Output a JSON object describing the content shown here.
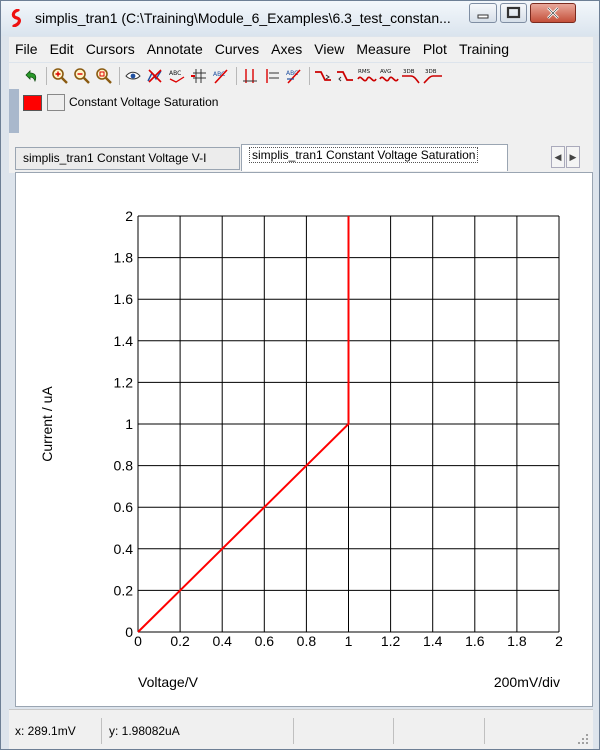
{
  "window": {
    "title": "simplis_tran1 (C:\\Training\\Module_6_Examples\\6.3_test_constan..."
  },
  "menu": [
    "File",
    "Edit",
    "Cursors",
    "Annotate",
    "Curves",
    "Axes",
    "View",
    "Measure",
    "Plot",
    "Training"
  ],
  "toolbar": {
    "icons": [
      "undo-icon",
      "zoom-in-icon",
      "zoom-out-icon",
      "zoom-fit-icon",
      "eye-icon",
      "delete-curve-icon",
      "abc-label-icon",
      "add-grid-icon",
      "abc-slash-icon",
      "cursor-lines-icon",
      "cursor-lines-2-icon",
      "abc-curve-icon",
      "edge-rise-icon",
      "edge-fall-icon",
      "rms-icon",
      "avg-icon",
      "3db-icon",
      "3db-up-icon"
    ],
    "text_labels": {
      "rms": "RMS",
      "avg": "AVG",
      "db1": "3DB",
      "db2": "3DB"
    }
  },
  "legend": {
    "label": "Constant Voltage Saturation",
    "color": "#ff0000"
  },
  "tabs": [
    {
      "label": "simplis_tran1 Constant Voltage V-I",
      "active": false
    },
    {
      "label": "simplis_tran1 Constant Voltage Saturation",
      "active": true
    }
  ],
  "chart_data": {
    "type": "line",
    "series": [
      {
        "name": "Constant Voltage Saturation",
        "color": "#ff0000",
        "x": [
          0,
          0.2,
          0.4,
          0.6,
          0.8,
          1,
          1,
          1
        ],
        "y": [
          0,
          0.2,
          0.4,
          0.6,
          0.8,
          1,
          1.5,
          2
        ]
      }
    ],
    "xlim": [
      0,
      2
    ],
    "ylim": [
      0,
      2
    ],
    "xticks": [
      "0",
      "0.2",
      "0.4",
      "0.6",
      "0.8",
      "1",
      "1.2",
      "1.4",
      "1.6",
      "1.8",
      "2"
    ],
    "yticks": [
      "0",
      "0.2",
      "0.4",
      "0.6",
      "0.8",
      "1",
      "1.2",
      "1.4",
      "1.6",
      "1.8",
      "2"
    ],
    "xlabel": "Voltage/V",
    "ylabel": "Current / uA",
    "scale_label": "200mV/div",
    "grid": true
  },
  "status": {
    "x": "x: 289.1mV",
    "y": "y: 1.98082uA"
  }
}
